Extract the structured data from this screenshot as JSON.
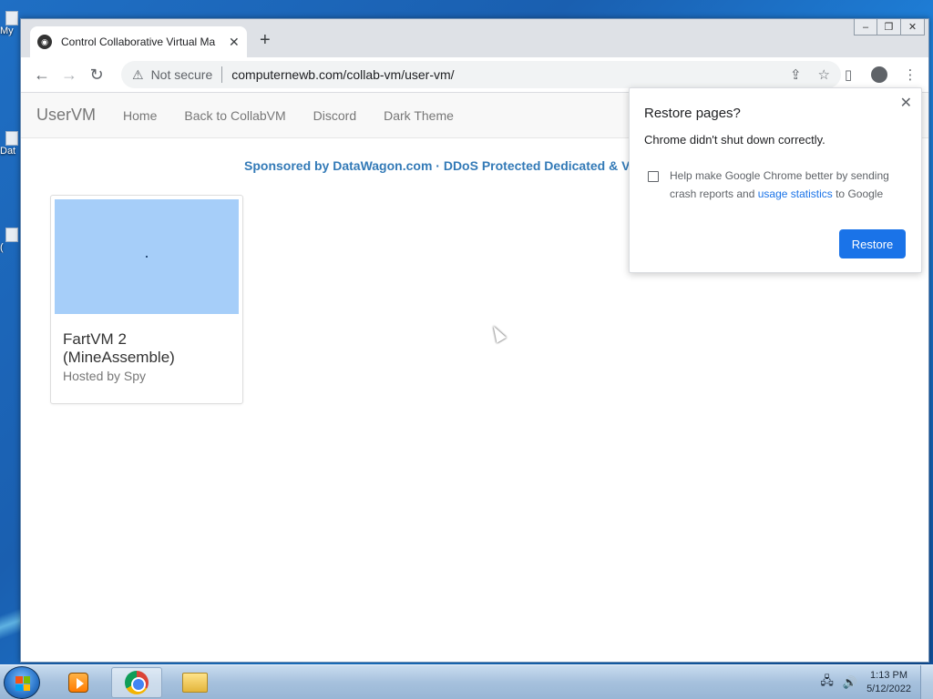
{
  "desktop": {
    "icons": [
      {
        "label": "My"
      },
      {
        "label": "Dat"
      },
      {
        "label": "("
      }
    ]
  },
  "browser": {
    "tab_title": "Control Collaborative Virtual Ma",
    "new_tab_label": "+",
    "window_buttons": {
      "minimize": "–",
      "restore": "❐",
      "close": "✕"
    },
    "security_label": "Not secure",
    "url": "computernewb.com/collab-vm/user-vm/",
    "icons": {
      "back": "←",
      "forward": "→",
      "reload": "↻",
      "warning": "⚠",
      "share": "⇪",
      "star": "☆",
      "sidepanel": "▯",
      "menu": "⋮"
    }
  },
  "site": {
    "brand": "UserVM",
    "nav": [
      {
        "label": "Home"
      },
      {
        "label": "Back to CollabVM"
      },
      {
        "label": "Discord"
      },
      {
        "label": "Dark Theme"
      }
    ],
    "sponsor_text": "Sponsored by DataWagon.com · DDoS Protected Dedicated & V",
    "vm_cards": [
      {
        "name": "FartVM 2 (MineAssemble)",
        "host": "Hosted by Spy"
      }
    ]
  },
  "restore_popup": {
    "title": "Restore pages?",
    "message": "Chrome didn't shut down correctly.",
    "checkbox_checked": false,
    "help_text_before": "Help make Google Chrome better by sending crash reports and ",
    "help_link": "usage statistics",
    "help_text_after": " to Google",
    "button": "Restore",
    "close_symbol": "✕",
    "accent_color": "#1a73e8"
  },
  "taskbar": {
    "apps": [
      {
        "name": "media-player",
        "active": false
      },
      {
        "name": "chrome",
        "active": true
      },
      {
        "name": "file-explorer",
        "active": false
      }
    ],
    "tray_icons": {
      "network": "🖧",
      "volume": "🔊"
    },
    "time": "1:13 PM",
    "date": "5/12/2022"
  }
}
